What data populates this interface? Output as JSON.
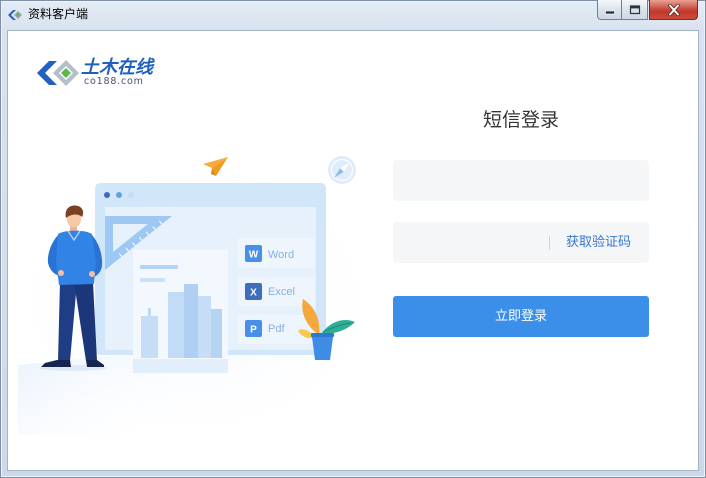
{
  "window": {
    "title": "资料客户端",
    "icons": {
      "app": "app-logo-icon",
      "minimize": "minimize-icon",
      "maximize": "maximize-icon",
      "close": "close-icon"
    }
  },
  "logo": {
    "name": "土木在线",
    "domain": "co188.com"
  },
  "login": {
    "title": "短信登录",
    "phone_field": {
      "value": ""
    },
    "code_field": {
      "value": "",
      "get_code_label": "获取验证码"
    },
    "submit_label": "立即登录"
  },
  "illustration": {
    "tiles": [
      {
        "badge": "W",
        "label": "Word"
      },
      {
        "badge": "X",
        "label": "Excel"
      },
      {
        "badge": "P",
        "label": "Pdf"
      }
    ]
  },
  "colors": {
    "accent": "#3c8fe9",
    "link": "#3677d3",
    "input_background": "#f5f6f8",
    "heading_text": "#333333",
    "close_button": "#c7473b",
    "brand_blue": "#1f5fbf",
    "brand_green": "#5cb84a"
  }
}
